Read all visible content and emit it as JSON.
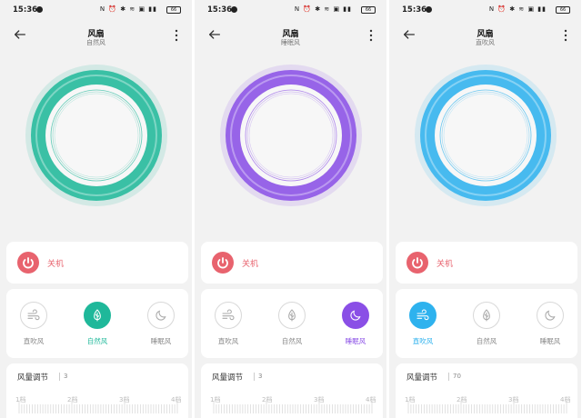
{
  "panels": [
    {
      "status": {
        "time": "15:36",
        "icons": "N ⏰ ✱ ≋ ▣ ▮▮",
        "battery": "66"
      },
      "header": {
        "title": "风扇",
        "subtitle": "自然风"
      },
      "accent": "#1fb89a",
      "power_label": "关机",
      "modes": [
        {
          "label": "直吹风",
          "icon": "wind-icon",
          "active": false
        },
        {
          "label": "自然风",
          "icon": "leaf-icon",
          "active": true
        },
        {
          "label": "睡眠风",
          "icon": "moon-icon",
          "active": false
        }
      ],
      "speed": {
        "title": "风量调节",
        "value": "3",
        "ticks": [
          "1档",
          "2档",
          "3档",
          "4档"
        ]
      }
    },
    {
      "status": {
        "time": "15:36",
        "icons": "N ⏰ ✱ ≋ ▣ ▮▮",
        "battery": "66"
      },
      "header": {
        "title": "风扇",
        "subtitle": "睡眠风"
      },
      "accent": "#8a4fe6",
      "power_label": "关机",
      "modes": [
        {
          "label": "直吹风",
          "icon": "wind-icon",
          "active": false
        },
        {
          "label": "自然风",
          "icon": "leaf-icon",
          "active": false
        },
        {
          "label": "睡眠风",
          "icon": "moon-icon",
          "active": true
        }
      ],
      "speed": {
        "title": "风量调节",
        "value": "3",
        "ticks": [
          "1档",
          "2档",
          "3档",
          "4档"
        ]
      }
    },
    {
      "status": {
        "time": "15:36",
        "icons": "N ⏰ ✱ ≋ ▣ ▮▮",
        "battery": "66"
      },
      "header": {
        "title": "风扇",
        "subtitle": "直吹风"
      },
      "accent": "#2eb2ee",
      "power_label": "关机",
      "modes": [
        {
          "label": "直吹风",
          "icon": "wind-icon",
          "active": true
        },
        {
          "label": "自然风",
          "icon": "leaf-icon",
          "active": false
        },
        {
          "label": "睡眠风",
          "icon": "moon-icon",
          "active": false
        }
      ],
      "speed": {
        "title": "风量调节",
        "value": "70",
        "ticks": [
          "1档",
          "2档",
          "3档",
          "4档"
        ]
      }
    }
  ],
  "colors": {
    "power": "#e8636e",
    "inactive_icon": "#aaaaaa"
  }
}
